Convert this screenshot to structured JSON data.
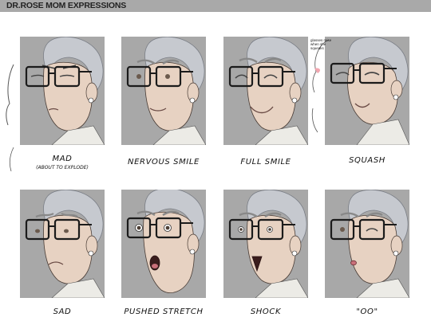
{
  "header": {
    "title": "DR.ROSE MOM EXPRESSIONS"
  },
  "panels": [
    {
      "label": "MAD",
      "sublabel": "(ABOUT TO EXPLODE)"
    },
    {
      "label": "NERVOUS SMILE"
    },
    {
      "label": "FULL SMILE"
    },
    {
      "label": "SQUASH",
      "note": "glasses raise when she squeaks"
    },
    {
      "label": "SAD"
    },
    {
      "label": "PUSHED STRETCH"
    },
    {
      "label": "SHOCK"
    },
    {
      "label": "\"OO\""
    }
  ],
  "colors": {
    "header_bg": "#a9a9a9",
    "panel_bg": "#a8a8a8",
    "skin": "#e7d2c2",
    "hair": "#c6c9cf",
    "glasses": "#1b1b1b",
    "blush": "#f2a6b0"
  }
}
